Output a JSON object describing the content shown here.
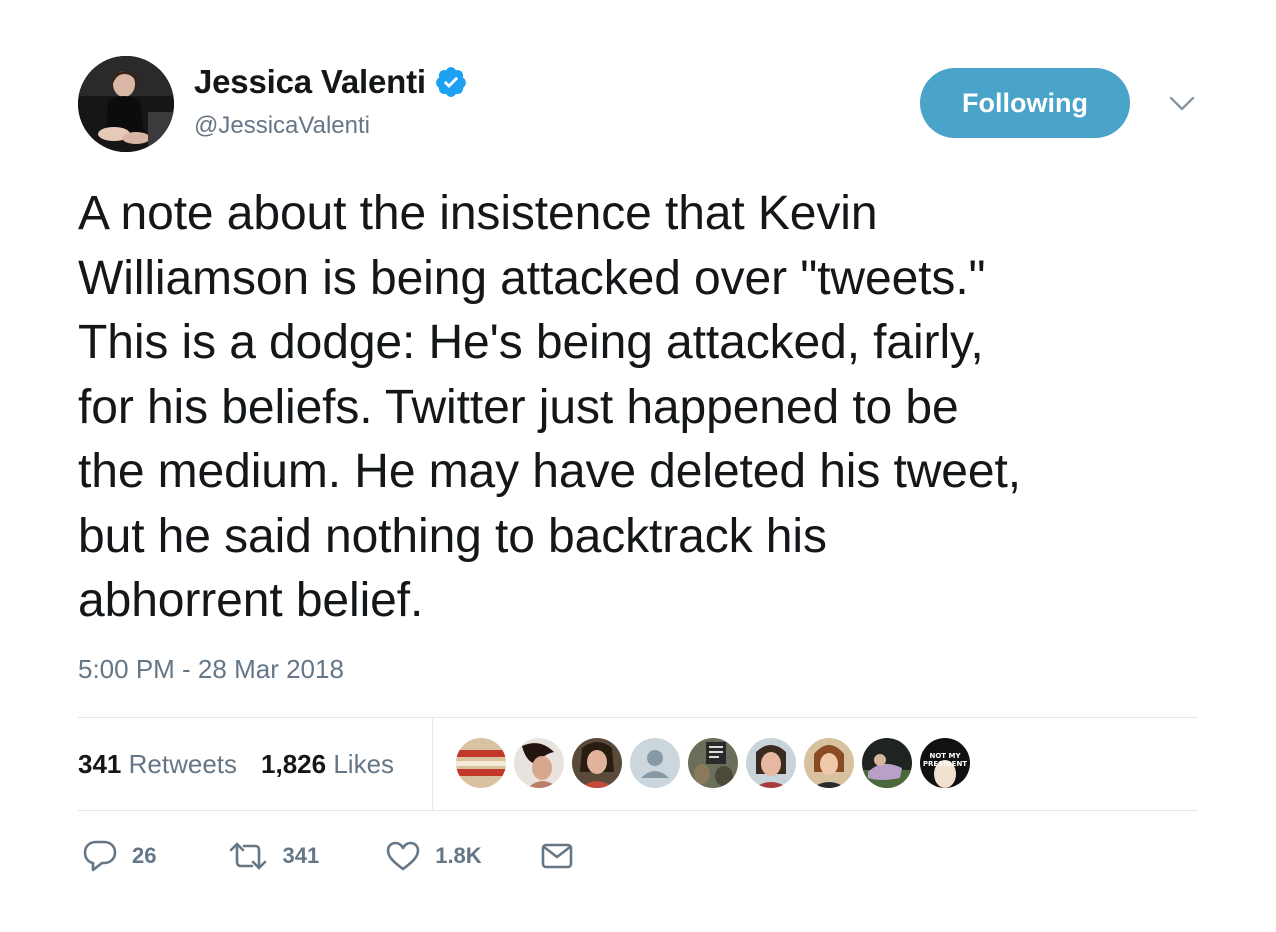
{
  "author": {
    "display_name": "Jessica Valenti",
    "handle": "@JessicaValenti",
    "verified": true
  },
  "follow_button": {
    "label": "Following"
  },
  "tweet": {
    "text_lines": [
      "A note about the insistence that Kevin",
      "Williamson is being attacked over \"tweets.\"",
      "This is a dodge: He's being attacked, fairly,",
      "for his beliefs. Twitter just happened to be",
      "the medium. He may have deleted his tweet,",
      "but he said nothing to backtrack his",
      "abhorrent belief."
    ],
    "timestamp": "5:00 PM - 28 Mar 2018"
  },
  "stats": {
    "retweets_count": "341",
    "retweets_label": "Retweets",
    "likes_count": "1,826",
    "likes_label": "Likes"
  },
  "actions": {
    "reply_count": "26",
    "retweet_count": "341",
    "like_count": "1.8K"
  },
  "liker_badge_text": "NOT MY PRESIDENT",
  "colors": {
    "accent": "#4aa3c9",
    "verified": "#1da1f2",
    "muted": "#657786",
    "text": "#14171a",
    "divider": "#e1e8ed"
  },
  "icons": [
    "verified-icon",
    "chevron-down-icon",
    "reply-icon",
    "retweet-icon",
    "heart-icon",
    "envelope-icon"
  ]
}
